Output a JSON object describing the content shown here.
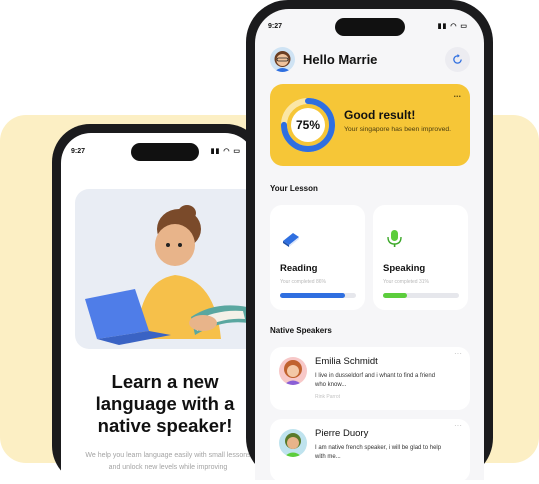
{
  "back_phone": {
    "status_time": "9:27",
    "title": "Learn a new language with a native speaker!",
    "subtitle": "We help you learn language easily with small lessons and unlock new levels while improving"
  },
  "front_phone": {
    "status_time": "9:27",
    "greeting": "Hello Marrie",
    "result": {
      "percent_label": "75%",
      "percent_value": 0.75,
      "title": "Good result!",
      "description": "Your singapore has been improved.",
      "more": "..."
    },
    "lesson_section": "Your Lesson",
    "lessons": [
      {
        "name": "Reading",
        "progress_text": "Your completed 86%",
        "progress": 0.86,
        "color": "#2f6fe0"
      },
      {
        "name": "Speaking",
        "progress_text": "Your completed 31%",
        "progress": 0.31,
        "color": "#5ccd3c"
      }
    ],
    "speakers_section": "Native Speakers",
    "speakers": [
      {
        "name": "Emilia Schmidt",
        "message": "I live in dusseldorf and i whant to find a friend who know...",
        "meta": "Rink Parrot"
      },
      {
        "name": "Pierre Duory",
        "message": "I am native french speaker, i will be glad to help with me...",
        "meta": ""
      }
    ]
  },
  "colors": {
    "background_band": "#fcefc4",
    "result_card": "#f6c637",
    "ring": "#2f6fe0",
    "reading": "#2f6fe0",
    "speaking": "#5ccd3c"
  }
}
